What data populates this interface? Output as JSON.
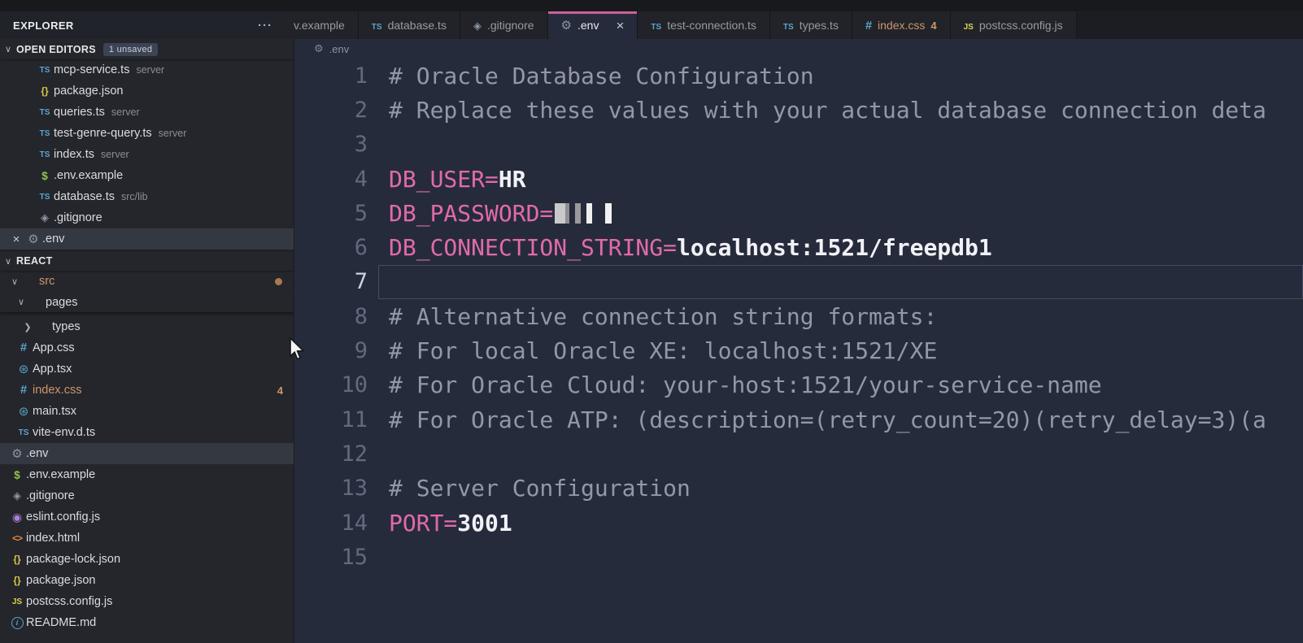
{
  "panel": {
    "title": "EXPLORER",
    "more_actions": "···"
  },
  "tabs": [
    {
      "label": "v.example",
      "icon": "none"
    },
    {
      "label": "database.ts",
      "icon": "ts"
    },
    {
      "label": ".gitignore",
      "icon": "gitignore"
    },
    {
      "label": ".env",
      "icon": "gear",
      "active": true,
      "close": "×"
    },
    {
      "label": "test-connection.ts",
      "icon": "ts"
    },
    {
      "label": "types.ts",
      "icon": "ts"
    },
    {
      "label": "index.css",
      "icon": "css",
      "badge": "4",
      "accent": true
    },
    {
      "label": "postcss.config.js",
      "icon": "js"
    }
  ],
  "open_editors": {
    "title": "OPEN EDITORS",
    "badge": "1 unsaved",
    "chevron": "∨",
    "items": [
      {
        "icon": "ts",
        "name": "mcp-service.ts",
        "desc": "server"
      },
      {
        "icon": "json",
        "name": "package.json"
      },
      {
        "icon": "ts",
        "name": "queries.ts",
        "desc": "server"
      },
      {
        "icon": "ts",
        "name": "test-genre-query.ts",
        "desc": "server"
      },
      {
        "icon": "ts",
        "name": "index.ts",
        "desc": "server"
      },
      {
        "icon": "dollar",
        "name": ".env.example"
      },
      {
        "icon": "ts",
        "name": "database.ts",
        "desc": "src/lib"
      },
      {
        "icon": "gitignore",
        "name": ".gitignore"
      },
      {
        "icon": "gear",
        "name": ".env",
        "selected": true,
        "close": "×"
      }
    ]
  },
  "explorer": {
    "title": "REACT",
    "chevron": "∨",
    "items": [
      {
        "kind": "folder",
        "chev": "∨",
        "name": "src",
        "level": 1,
        "accent": true,
        "dot": true
      },
      {
        "kind": "folder",
        "chev": "∨",
        "name": "pages",
        "level": 2,
        "sticky_last": true
      },
      {
        "kind": "folder",
        "chev": "❯",
        "name": "types",
        "level": 3
      },
      {
        "icon": "css",
        "name": "App.css",
        "level": 2
      },
      {
        "icon": "react",
        "name": "App.tsx",
        "level": 2
      },
      {
        "icon": "css",
        "name": "index.css",
        "level": 2,
        "accent": true,
        "badge": "4"
      },
      {
        "icon": "react",
        "name": "main.tsx",
        "level": 2
      },
      {
        "icon": "ts",
        "name": "vite-env.d.ts",
        "level": 2
      },
      {
        "icon": "gear",
        "name": ".env",
        "level": 1,
        "selected": true
      },
      {
        "icon": "dollar",
        "name": ".env.example",
        "level": 1
      },
      {
        "icon": "gitignore",
        "name": ".gitignore",
        "level": 1
      },
      {
        "icon": "eslint",
        "name": "eslint.config.js",
        "level": 1
      },
      {
        "icon": "html",
        "name": "index.html",
        "level": 1
      },
      {
        "icon": "json",
        "name": "package-lock.json",
        "level": 1
      },
      {
        "icon": "json",
        "name": "package.json",
        "level": 1
      },
      {
        "icon": "js",
        "name": "postcss.config.js",
        "level": 1
      },
      {
        "icon": "readme",
        "name": "README.md",
        "level": 1
      }
    ]
  },
  "breadcrumb": {
    "icon": "gear",
    "label": ".env"
  },
  "editor": {
    "lines": [
      {
        "n": "1",
        "parts": [
          {
            "t": "# Oracle Database Configuration",
            "c": "comment"
          }
        ]
      },
      {
        "n": "2",
        "parts": [
          {
            "t": "# Replace these values with your actual database connection deta",
            "c": "comment"
          }
        ]
      },
      {
        "n": "3",
        "parts": []
      },
      {
        "n": "4",
        "parts": [
          {
            "t": "DB_USER=",
            "c": "key"
          },
          {
            "t": "HR",
            "c": "value"
          }
        ]
      },
      {
        "n": "5",
        "parts": [
          {
            "t": "DB_PASSWORD=",
            "c": "key"
          },
          {
            "t": "",
            "c": "redacted"
          }
        ]
      },
      {
        "n": "6",
        "parts": [
          {
            "t": "DB_CONNECTION_STRING=",
            "c": "key"
          },
          {
            "t": "localhost:1521/freepdb1",
            "c": "value"
          }
        ]
      },
      {
        "n": "7",
        "parts": [],
        "current": true
      },
      {
        "n": "8",
        "parts": [
          {
            "t": "# Alternative connection string formats:",
            "c": "comment"
          }
        ]
      },
      {
        "n": "9",
        "parts": [
          {
            "t": "# For local Oracle XE: localhost:1521/XE",
            "c": "comment"
          }
        ]
      },
      {
        "n": "10",
        "parts": [
          {
            "t": "# For Oracle Cloud: your-host:1521/your-service-name",
            "c": "comment"
          }
        ]
      },
      {
        "n": "11",
        "parts": [
          {
            "t": "# For Oracle ATP: (description=(retry_count=20)(retry_delay=3)(a",
            "c": "comment"
          }
        ]
      },
      {
        "n": "12",
        "parts": []
      },
      {
        "n": "13",
        "parts": [
          {
            "t": "# Server Configuration",
            "c": "comment"
          }
        ]
      },
      {
        "n": "14",
        "parts": [
          {
            "t": "PORT=",
            "c": "key"
          },
          {
            "t": "3001",
            "c": "value"
          }
        ]
      },
      {
        "n": "15",
        "parts": []
      }
    ]
  },
  "colors": {
    "editor_bg": "#262b3c",
    "sidebar_bg": "#24262b",
    "active_tab_accent": "#cf5f9b",
    "env_key": "#e16ba9",
    "comment": "#9298a8",
    "modified_orange": "#cd9669"
  }
}
